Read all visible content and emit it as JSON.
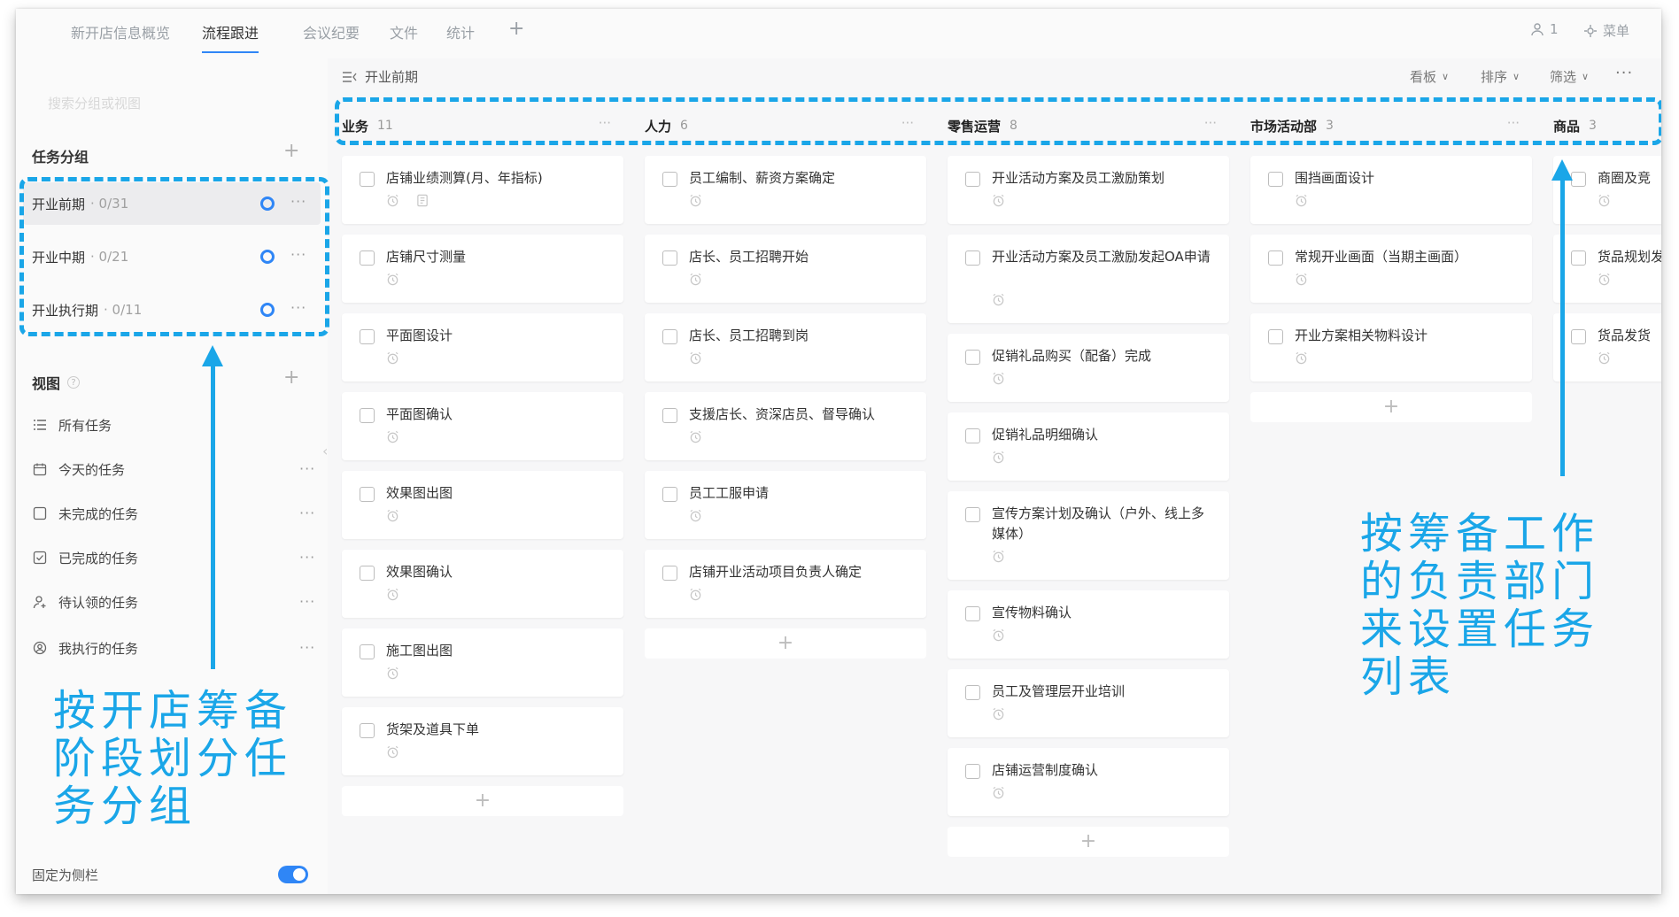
{
  "tabs": [
    {
      "label": "新开店信息概览",
      "active": false
    },
    {
      "label": "流程跟进",
      "active": true
    },
    {
      "label": "会议纪要",
      "active": false
    },
    {
      "label": "文件",
      "active": false
    },
    {
      "label": "统计",
      "active": false
    }
  ],
  "topbar": {
    "add": "+",
    "members_icon": "person-icon",
    "members_count": "1",
    "menu_label": "菜单"
  },
  "sidebar": {
    "search_placeholder": "搜索分组或视图",
    "groups_title": "任务分组",
    "groups": [
      {
        "name": "开业前期",
        "count": "· 0/31",
        "active": true
      },
      {
        "name": "开业中期",
        "count": "· 0/21",
        "active": false
      },
      {
        "name": "开业执行期",
        "count": "· 0/11",
        "active": false
      }
    ],
    "views_title": "视图",
    "views": [
      {
        "label": "所有任务",
        "icon": "list-icon",
        "dots": false
      },
      {
        "label": "今天的任务",
        "icon": "calendar-icon",
        "dots": true
      },
      {
        "label": "未完成的任务",
        "icon": "checkbox-empty-icon",
        "dots": true
      },
      {
        "label": "已完成的任务",
        "icon": "checkbox-checked-icon",
        "dots": true
      },
      {
        "label": "待认领的任务",
        "icon": "person-add-icon",
        "dots": true
      },
      {
        "label": "我执行的任务",
        "icon": "user-circle-icon",
        "dots": true
      }
    ],
    "pin_label": "固定为侧栏",
    "pin_on": true
  },
  "main": {
    "title": "开业前期",
    "options": [
      {
        "label": "看板"
      },
      {
        "label": "排序"
      },
      {
        "label": "筛选"
      }
    ]
  },
  "columns": [
    {
      "name": "业务",
      "count": "11",
      "cards": [
        "店铺业绩测算(月、年指标)",
        "店铺尺寸测量",
        "平面图设计",
        "平面图确认",
        "效果图出图",
        "效果图确认",
        "施工图出图",
        "货架及道具下单"
      ]
    },
    {
      "name": "人力",
      "count": "6",
      "cards": [
        "员工编制、薪资方案确定",
        "店长、员工招聘开始",
        "店长、员工招聘到岗",
        "支援店长、资深店员、督导确认",
        "员工工服申请",
        "店铺开业活动项目负责人确定"
      ]
    },
    {
      "name": "零售运营",
      "count": "8",
      "cards": [
        "开业活动方案及员工激励策划",
        "开业活动方案及员工激励发起OA申请",
        "促销礼品购买（配备）完成",
        "促销礼品明细确认",
        "宣传方案计划及确认（户外、线上多媒体）",
        "宣传物料确认",
        "员工及管理层开业培训",
        "店铺运营制度确认"
      ]
    },
    {
      "name": "市场活动部",
      "count": "3",
      "cards": [
        "围挡画面设计",
        "常规开业画面（当期主画面）",
        "开业方案相关物料设计"
      ]
    },
    {
      "name": "商品",
      "count": "3",
      "cards": [
        "商圈及竞",
        "货品规划发货时间",
        "货品发货"
      ]
    }
  ],
  "annotations": {
    "left": "按开店筹备阶段划分任务分组",
    "right": "按筹备工作的负责部门来设置任务列表"
  }
}
